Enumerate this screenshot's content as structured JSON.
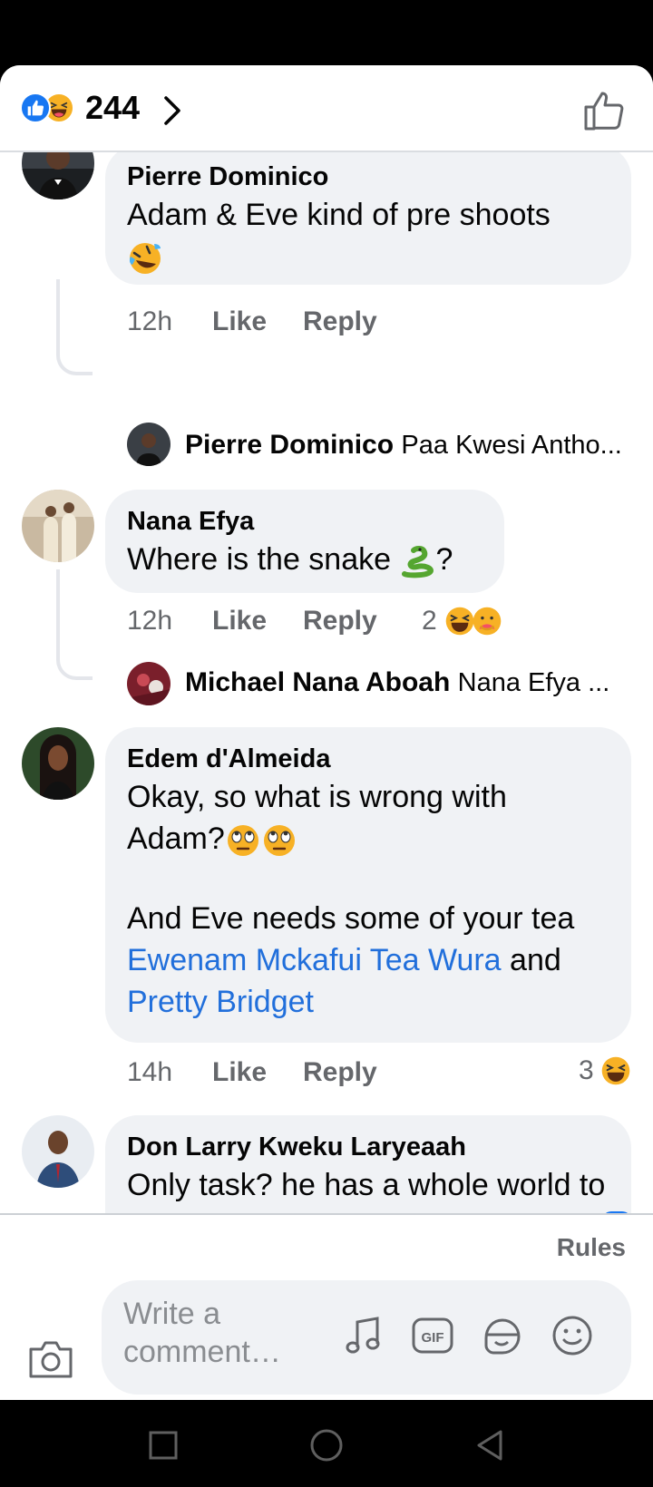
{
  "header": {
    "reaction_total": "244",
    "reaction_icons": [
      "like-icon",
      "haha-icon"
    ]
  },
  "comments": [
    {
      "author": "Pierre Dominico",
      "text": "Adam & Eve kind of pre shoots",
      "emoji": "rolling-laugh-emoji",
      "time": "12h",
      "like": "Like",
      "reply": "Reply",
      "reply_preview": {
        "author": "Pierre Dominico",
        "text": "Paa Kwesi Antho..."
      }
    },
    {
      "author": "Nana Efya",
      "text_before": "Where is the snake ",
      "emoji": "snake-emoji",
      "text_after": "?",
      "time": "12h",
      "like": "Like",
      "reply": "Reply",
      "reaction_count": "2",
      "reply_preview": {
        "author": "Michael Nana Aboah",
        "text": "Nana Efya ..."
      }
    },
    {
      "author": "Edem d'Almeida",
      "line1": "Okay, so what is wrong with",
      "line2": "Adam?",
      "emoji": "eye-roll-emoji",
      "line3": "And Eve needs some of your tea",
      "mention1": "Ewenam Mckafui Tea Wura",
      "joiner": " and",
      "mention2": "Pretty Bridget",
      "time": "14h",
      "like": "Like",
      "reply": "Reply",
      "reaction_count": "3"
    },
    {
      "author": "Don Larry Kweku Laryeaah",
      "text": "Only task? he has a whole world to manage"
    }
  ],
  "composer": {
    "rules": "Rules",
    "placeholder": "Write a comment…",
    "tools": [
      "music-icon",
      "gif-icon",
      "sticker-icon",
      "emoji-icon"
    ]
  },
  "colors": {
    "accent": "#1877f2",
    "mention": "#216fdb",
    "bubble": "#f0f2f5",
    "meta": "#65676b"
  }
}
